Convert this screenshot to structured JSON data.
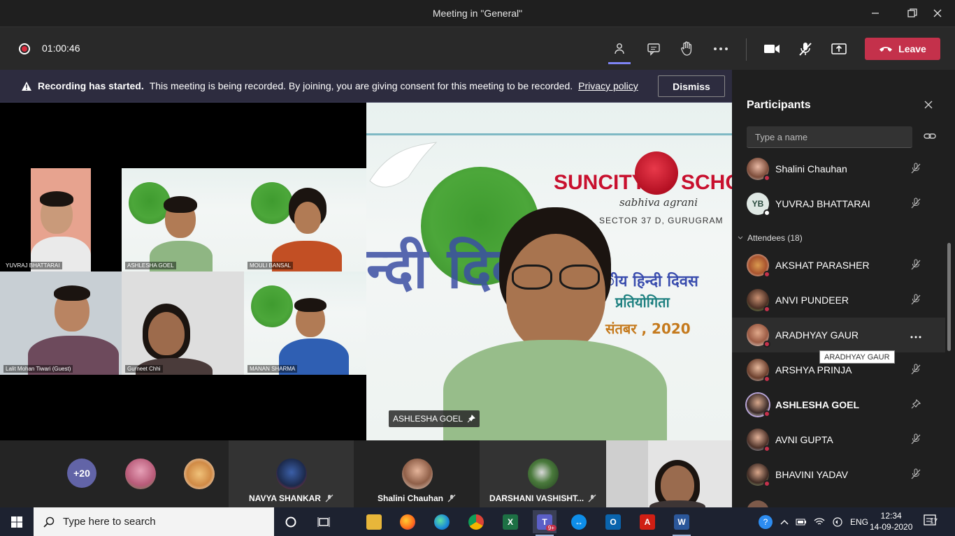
{
  "window": {
    "title": "Meeting in \"General\""
  },
  "toolbar": {
    "timer": "01:00:46",
    "leave_label": "Leave"
  },
  "banner": {
    "bold": "Recording has started.",
    "text": "This meeting is being recorded. By joining, you are giving consent for this meeting to be recorded.",
    "link": "Privacy policy",
    "dismiss": "Dismiss"
  },
  "share_tiles": [
    {
      "name": "YUVRAJ BHATTARAI"
    },
    {
      "name": "ASHLESHA GOEL"
    },
    {
      "name": "MOULI BANSAL"
    },
    {
      "name": "Lalit Mohan Tiwari (Guest)"
    },
    {
      "name": "Gurneet Chhi"
    },
    {
      "name": "MANAN SHARMA"
    }
  ],
  "main_video": {
    "name": "ASHLESHA GOEL",
    "suncity": "SUNCITY",
    "school": "SCHO",
    "tagline": "sabhiva agrani",
    "sector": "SECTOR 37 D, GURUGRAM",
    "hindi_big": "न्दी दिवस",
    "hindi_line1": "ीय हिन्दी दिवस",
    "hindi_line2": "प्रतियोगिता",
    "hindi_line3": "संतबर , 2020"
  },
  "bottom_row": {
    "overflow_count": "+20",
    "tiles": [
      {
        "name": "NAVYA SHANKAR"
      },
      {
        "name": "Shalini Chauhan"
      },
      {
        "name": "DARSHANI VASHISHT..."
      }
    ]
  },
  "panel": {
    "title": "Participants",
    "search_placeholder": "Type a name",
    "attendees_header": "Attendees (18)",
    "tooltip": "ARADHYAY GAUR",
    "presenters": [
      {
        "name": "Shalini Chauhan"
      },
      {
        "name": "YUVRAJ BHATTARAI",
        "initials": "YB"
      }
    ],
    "attendees": [
      {
        "name": "AKSHAT PARASHER"
      },
      {
        "name": "ANVI PUNDEER"
      },
      {
        "name": "ARADHYAY GAUR"
      },
      {
        "name": "ARSHYA PRINJA"
      },
      {
        "name": "ASHLESHA GOEL"
      },
      {
        "name": "AVNI GUPTA"
      },
      {
        "name": "BHAVINI YADAV"
      }
    ]
  },
  "taskbar": {
    "search_placeholder": "Type here to search",
    "language": "ENG",
    "time": "12:34",
    "date": "14-09-2020",
    "notif_count": "17",
    "teams_badge": "9+"
  }
}
